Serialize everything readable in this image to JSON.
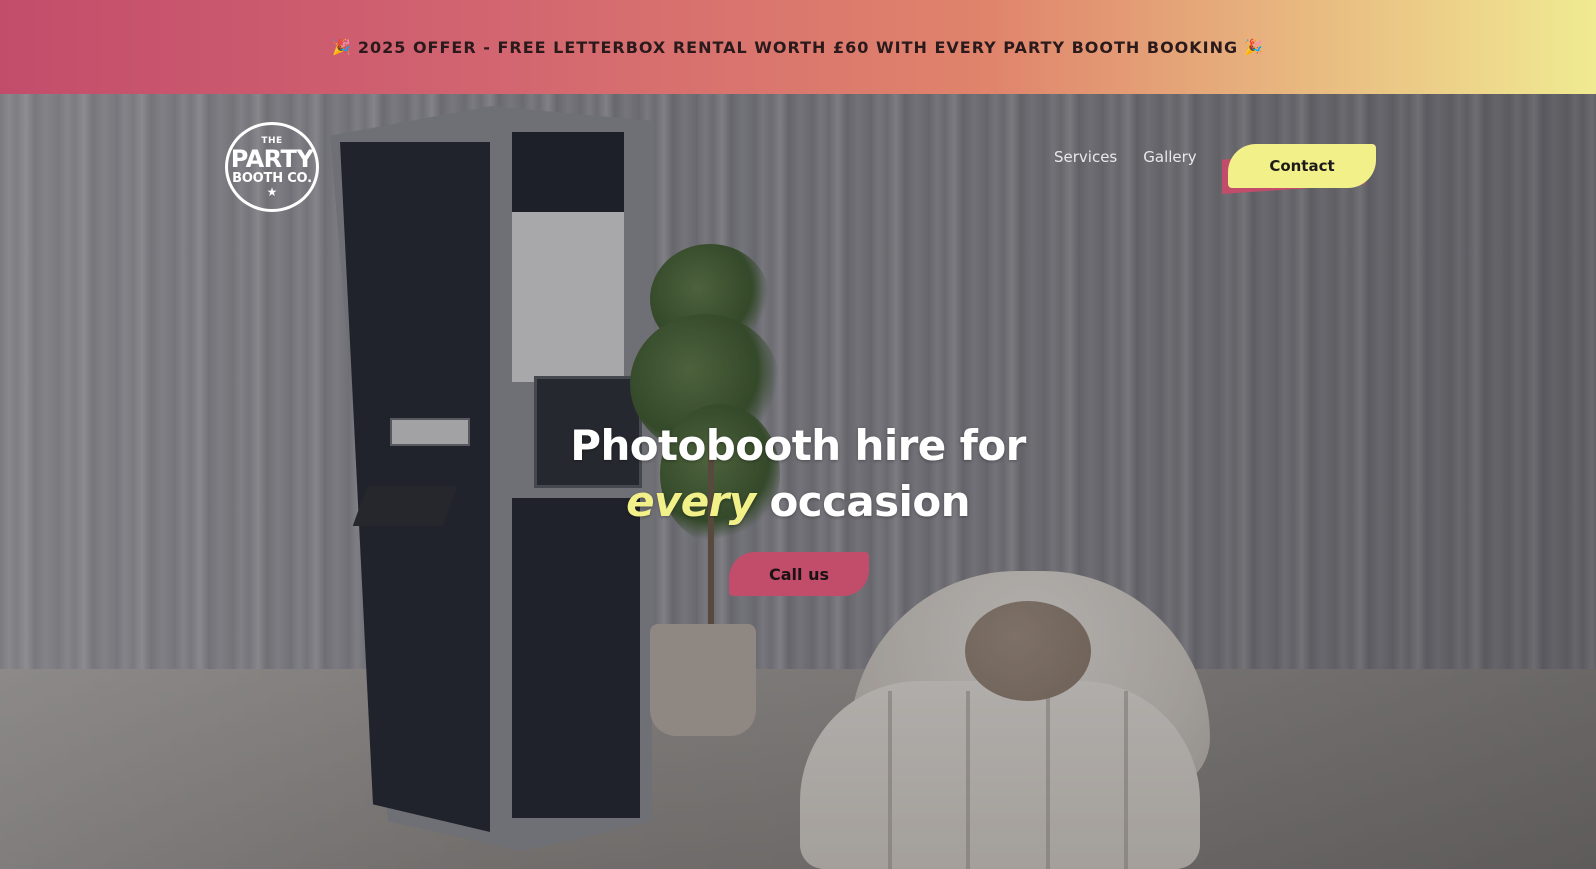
{
  "promo": {
    "text": "2025 OFFER - FREE LETTERBOX RENTAL WORTH £60 WITH EVERY PARTY BOOTH BOOKING",
    "emoji_left": "🎉",
    "emoji_right": "🎉",
    "gradient_colors": [
      "#c24d6b",
      "#e0846c",
      "#f0ea92"
    ]
  },
  "logo": {
    "line1": "THE",
    "line2": "PARTY",
    "line3": "BOOTH CO.",
    "star": "★"
  },
  "nav": {
    "items": [
      {
        "label": "Services"
      },
      {
        "label": "Gallery"
      }
    ],
    "contact_label": "Contact"
  },
  "hero": {
    "title_line1": "Photobooth hire for",
    "title_accent": "every",
    "title_line2_rest": " occasion",
    "cta_label": "Call us"
  },
  "colors": {
    "accent_yellow": "#f2f088",
    "accent_pink": "#c24d6b"
  }
}
